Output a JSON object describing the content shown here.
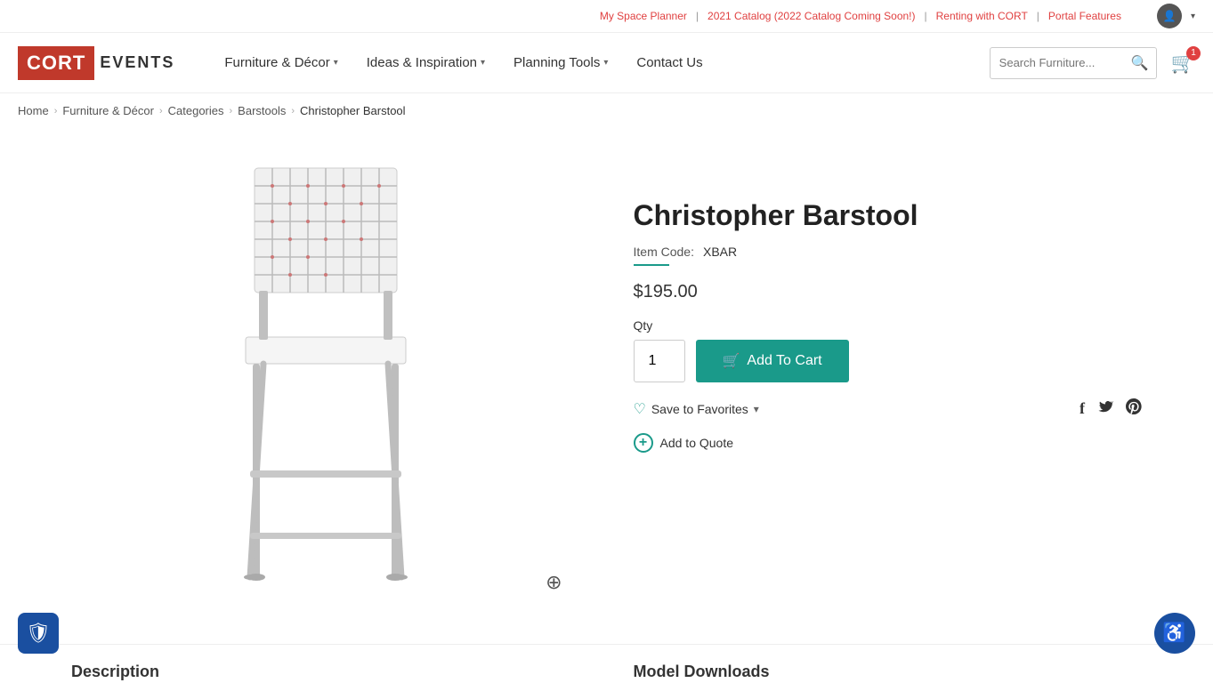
{
  "topbar": {
    "link1": "My Space Planner",
    "link2": "2021 Catalog (2022 Catalog Coming Soon!)",
    "link3": "Renting with CORT",
    "link4": "Portal Features"
  },
  "header": {
    "logo_brand": "CORT",
    "logo_sub": "EVENTS",
    "nav": [
      {
        "label": "Furniture & Décor",
        "has_dropdown": true
      },
      {
        "label": "Ideas & Inspiration",
        "has_dropdown": true
      },
      {
        "label": "Planning Tools",
        "has_dropdown": true
      },
      {
        "label": "Contact Us",
        "has_dropdown": false
      }
    ],
    "search_placeholder": "Search Furniture...",
    "cart_count": "1"
  },
  "breadcrumb": {
    "items": [
      "Home",
      "Furniture & Décor",
      "Categories",
      "Barstools",
      "Christopher Barstool"
    ]
  },
  "product": {
    "title": "Christopher Barstool",
    "item_code_label": "Item Code:",
    "item_code": "XBAR",
    "price": "$195.00",
    "qty_label": "Qty",
    "qty_value": "1",
    "add_to_cart_label": "Add To Cart",
    "save_favorites_label": "Save to Favorites",
    "add_to_quote_label": "Add to Quote"
  },
  "bottom": {
    "description_title": "Description",
    "model_downloads_title": "Model Downloads"
  },
  "icons": {
    "cart": "🛒",
    "user": "👤",
    "search": "🔍",
    "heart": "♡",
    "plus": "+",
    "chevron_down": "▾",
    "facebook": "f",
    "twitter": "t",
    "pinterest": "p",
    "zoom": "⊕",
    "accessibility": "♿",
    "shield": "🛡"
  }
}
